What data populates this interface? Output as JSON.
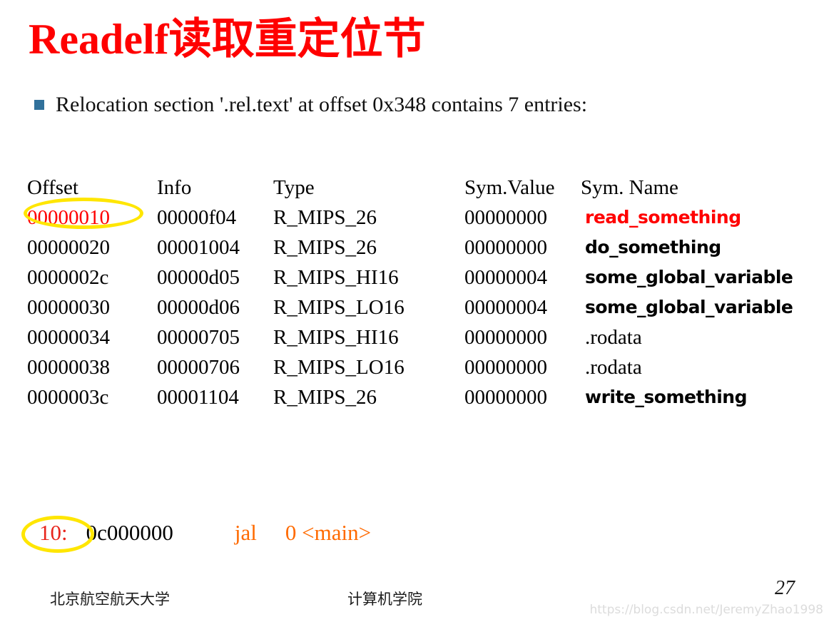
{
  "slide": {
    "title": "Readelf读取重定位节",
    "bullet": {
      "marker_color": "#31719b",
      "text": "Relocation section '.rel.text' at offset 0x348 contains 7 entries:"
    },
    "title_color": "#ff0000",
    "highlight_color": "#ffe600"
  },
  "reloc_table": {
    "headers": {
      "offset": "Offset",
      "info": "Info",
      "type": "Type",
      "value": "Sym.Value",
      "name": "Sym. Name"
    },
    "rows": [
      {
        "offset": "00000010",
        "info": "00000f04",
        "type": "R_MIPS_26",
        "value": "00000000",
        "name": "read_something",
        "offset_color": "#ff0000",
        "name_color": "#ff0000",
        "name_style": "bold",
        "highlighted": true
      },
      {
        "offset": "00000020",
        "info": "00001004",
        "type": "R_MIPS_26",
        "value": "00000000",
        "name": "do_something",
        "offset_color": "#000000",
        "name_color": "#000000",
        "name_style": "bold",
        "highlighted": false
      },
      {
        "offset": "0000002c",
        "info": "00000d05",
        "type": "R_MIPS_HI16",
        "value": "00000004",
        "name": "some_global_variable",
        "offset_color": "#000000",
        "name_color": "#000000",
        "name_style": "bold",
        "highlighted": false
      },
      {
        "offset": "00000030",
        "info": "00000d06",
        "type": "R_MIPS_LO16",
        "value": "00000004",
        "name": "some_global_variable",
        "offset_color": "#000000",
        "name_color": "#000000",
        "name_style": "bold",
        "highlighted": false
      },
      {
        "offset": "00000034",
        "info": "00000705",
        "type": "R_MIPS_HI16",
        "value": "00000000",
        "name": ".rodata",
        "offset_color": "#000000",
        "name_color": "#000000",
        "name_style": "plain",
        "highlighted": false
      },
      {
        "offset": "00000038",
        "info": "00000706",
        "type": "R_MIPS_LO16",
        "value": "00000000",
        "name": ".rodata",
        "offset_color": "#000000",
        "name_color": "#000000",
        "name_style": "plain",
        "highlighted": false
      },
      {
        "offset": "0000003c",
        "info": "00001104",
        "type": "R_MIPS_26",
        "value": "00000000",
        "name": "write_something",
        "offset_color": "#000000",
        "name_color": "#000000",
        "name_style": "bold",
        "highlighted": false
      }
    ]
  },
  "disassembly": {
    "address": "10:",
    "bytes": "0c000000",
    "mnemonic": "jal",
    "operand": "0 <main>",
    "address_color": "#e8251c",
    "mnemonic_color": "#ff6a00",
    "highlighted": true
  },
  "footer": {
    "university": "北京航空航天大学",
    "school": "计算机学院",
    "page_number": "27",
    "watermark": "https://blog.csdn.net/JeremyZhao1998"
  }
}
